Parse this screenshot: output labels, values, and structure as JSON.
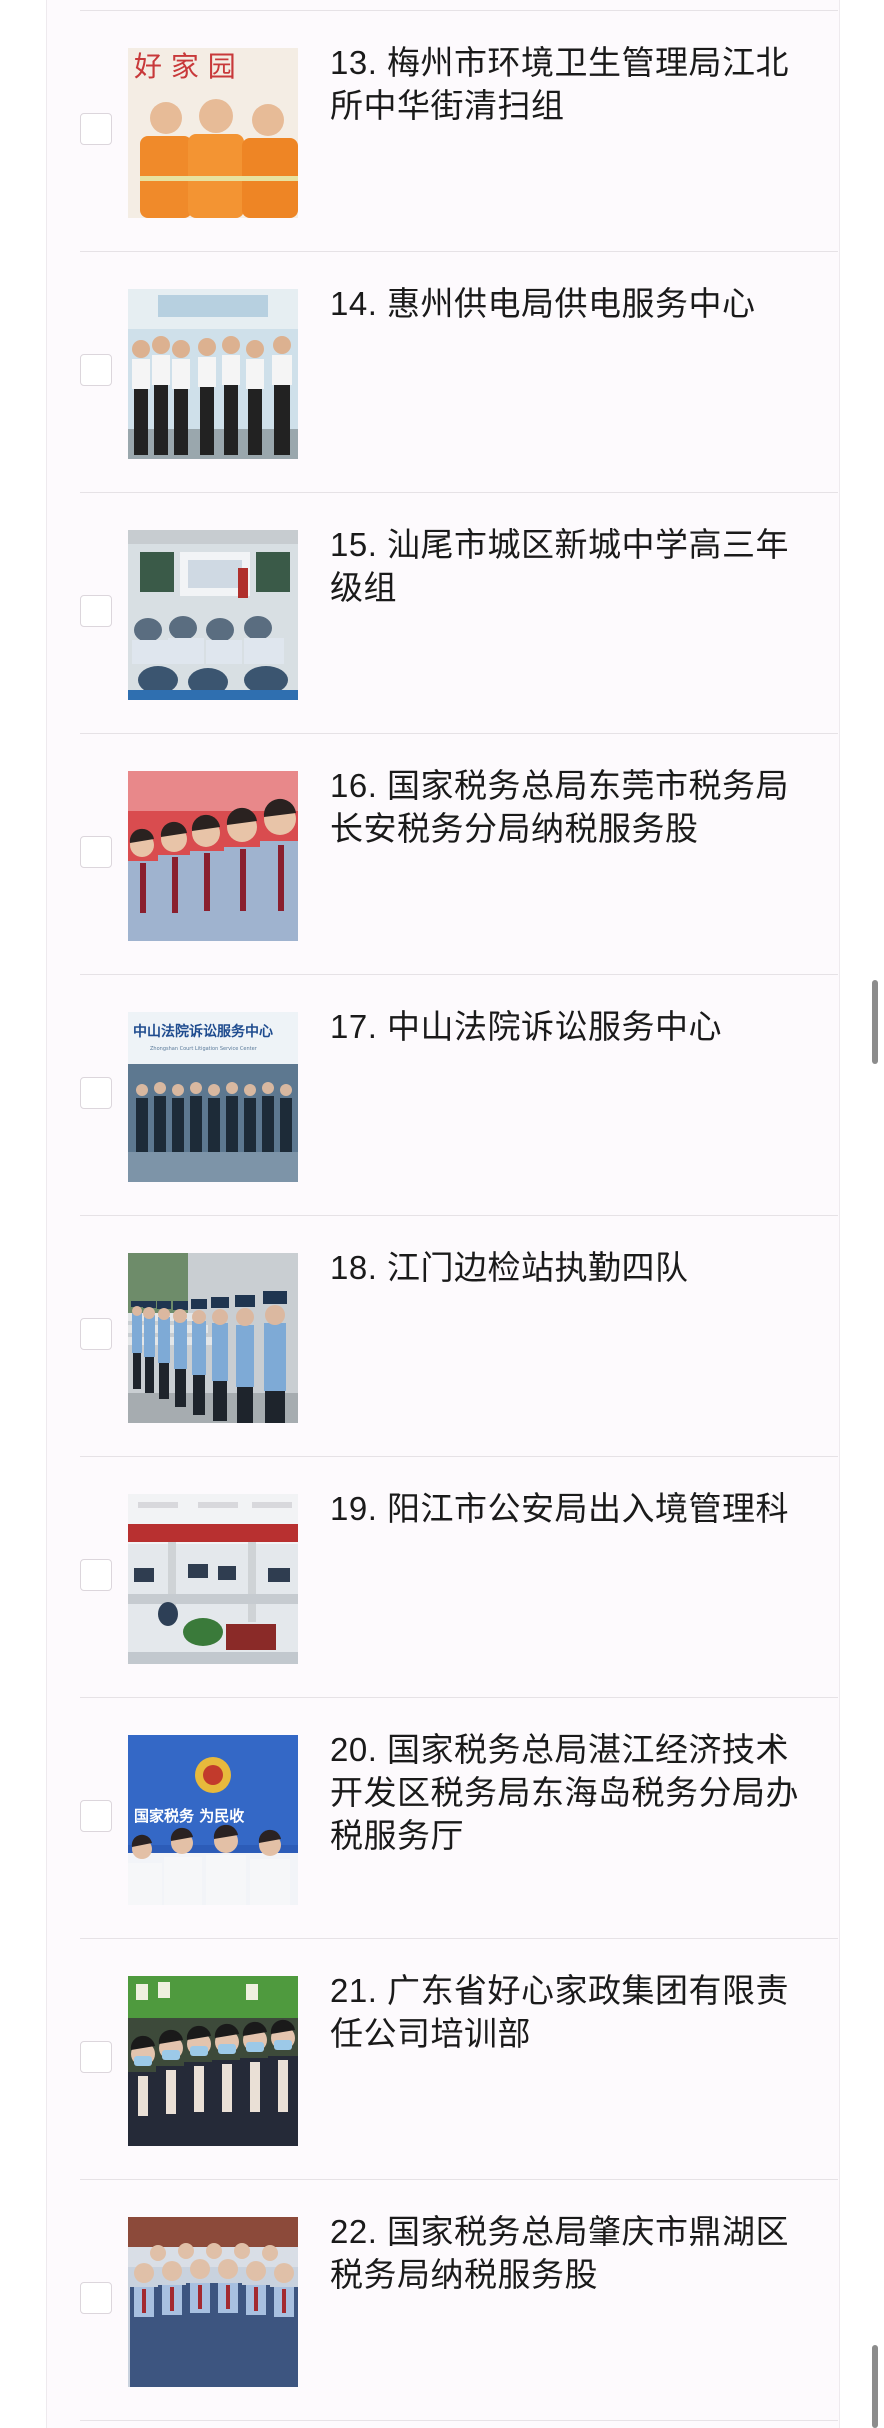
{
  "list": {
    "items": [
      {
        "title": "13. 梅州市环境卫生管理局江北所中华街清扫组",
        "thumb_icon": "sanitation-workers-photo"
      },
      {
        "title": "14. 惠州供电局供电服务中心",
        "thumb_icon": "power-service-staff-photo"
      },
      {
        "title": "15. 汕尾市城区新城中学高三年级组",
        "thumb_icon": "classroom-photo"
      },
      {
        "title": "16. 国家税务总局东莞市税务局长安税务分局纳税服务股",
        "thumb_icon": "tax-officers-photo",
        "thumb_text": ""
      },
      {
        "title": "17. 中山法院诉讼服务中心",
        "thumb_icon": "court-service-center-photo",
        "thumb_text": "中山法院诉讼服务中心",
        "thumb_subtext": "Zhongshan Court Litigation Service Center"
      },
      {
        "title": "18. 江门边检站执勤四队",
        "thumb_icon": "border-police-photo"
      },
      {
        "title": "19. 阳江市公安局出入境管理科",
        "thumb_icon": "police-office-photo"
      },
      {
        "title": "20. 国家税务总局湛江经济技术开发区税务局东海岛税务分局办税服务厅",
        "thumb_icon": "tax-hall-photo",
        "thumb_text": "国家税务  为民收"
      },
      {
        "title": "21. 广东省好心家政集团有限责任公司培训部",
        "thumb_icon": "housekeeping-trainees-photo"
      },
      {
        "title": "22. 国家税务总局肇庆市鼎湖区税务局纳税服务股",
        "thumb_icon": "tax-staff-group-photo"
      }
    ]
  },
  "thumb_13_text": "好 家 园"
}
